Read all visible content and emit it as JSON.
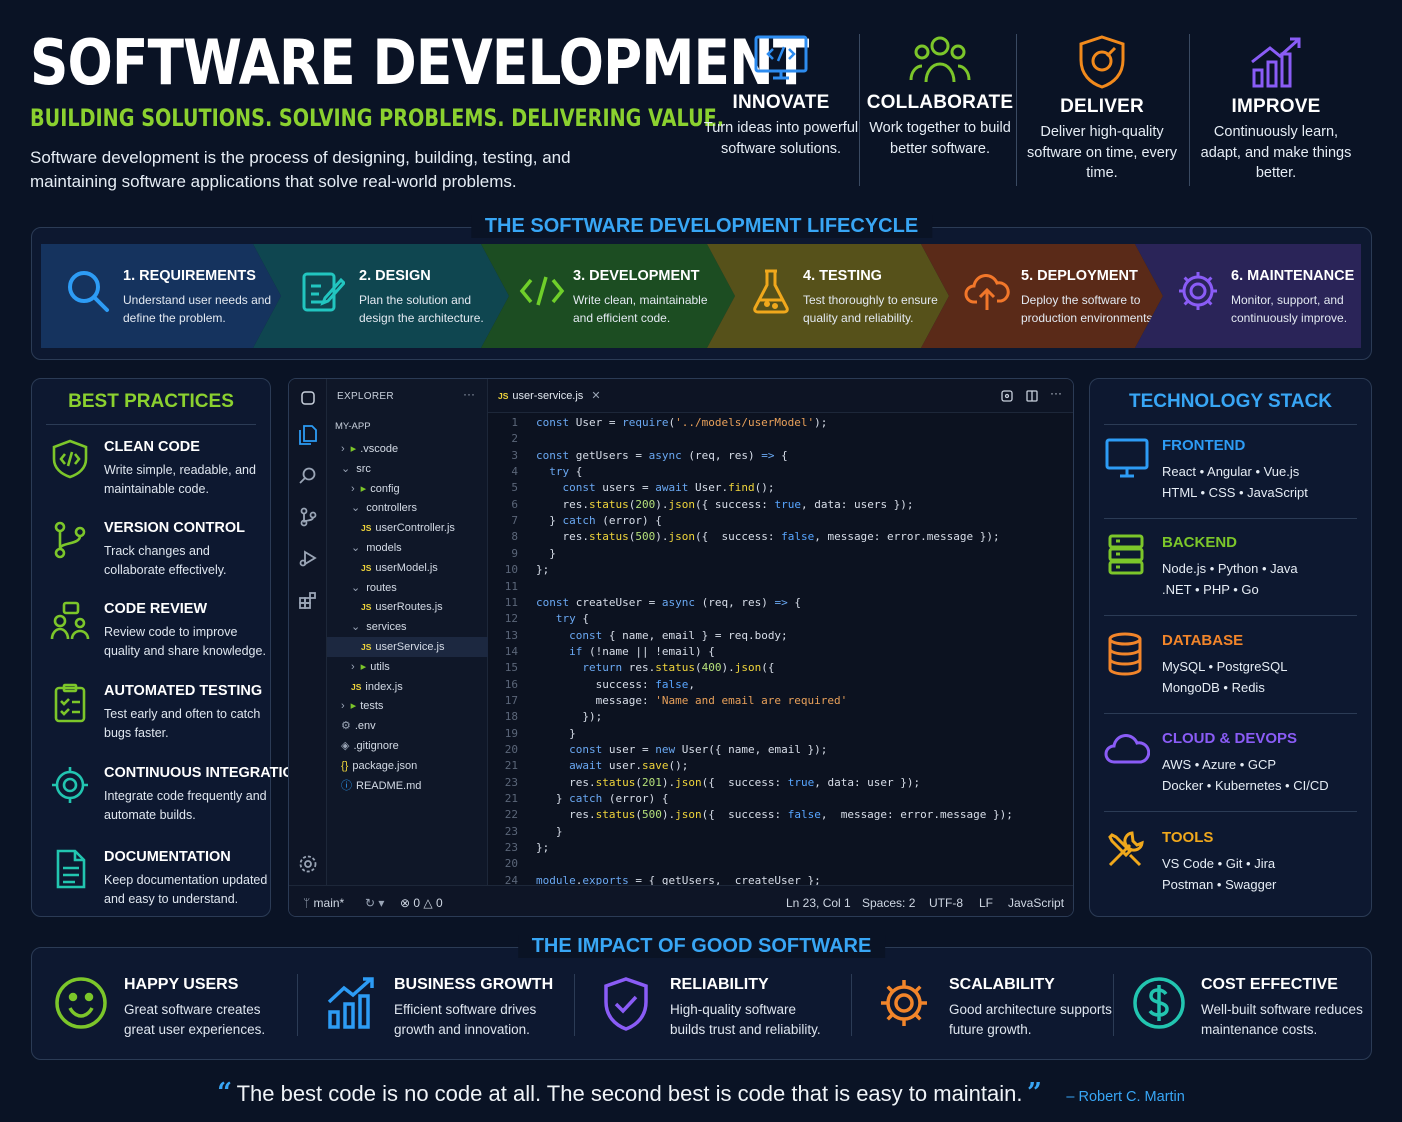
{
  "header": {
    "title": "SOFTWARE DEVELOPMENT",
    "tagline": "BUILDING SOLUTIONS. SOLVING PROBLEMS. DELIVERING VALUE.",
    "intro": "Software development is the process of designing, building, testing, and maintaining software applications that solve real-world problems."
  },
  "pillars": [
    {
      "title": "INNOVATE",
      "desc": "Turn ideas into powerful software solutions.",
      "icon": "monitor-code-icon",
      "color": "#2d8cf0"
    },
    {
      "title": "COLLABORATE",
      "desc": "Work together to build better software.",
      "icon": "team-icon",
      "color": "#7cc62a"
    },
    {
      "title": "DELIVER",
      "desc": "Deliver high-quality software on time, every time.",
      "icon": "shield-target-icon",
      "color": "#f28a1c"
    },
    {
      "title": "IMPROVE",
      "desc": "Continuously learn, adapt, and make things better.",
      "icon": "growth-chart-icon",
      "color": "#8a5cf6"
    }
  ],
  "lifecycle": {
    "heading": "THE SOFTWARE DEVELOPMENT LIFECYCLE",
    "stages": [
      {
        "title": "1. REQUIREMENTS",
        "desc": "Understand user needs and define the problem.",
        "icon": "search-icon",
        "color": "#15335e",
        "accent": "#2d9cf5"
      },
      {
        "title": "2. DESIGN",
        "desc": "Plan the solution and design the architecture.",
        "icon": "design-edit-icon",
        "color": "#0f4650",
        "accent": "#22c5c0"
      },
      {
        "title": "3. DEVELOPMENT",
        "desc": "Write clean, maintainable and efficient code.",
        "icon": "code-brackets-icon",
        "color": "#1c4d22",
        "accent": "#6fcf2a"
      },
      {
        "title": "4. TESTING",
        "desc": "Test thoroughly to ensure quality and reliability.",
        "icon": "flask-icon",
        "color": "#56511a",
        "accent": "#f0a81c"
      },
      {
        "title": "5. DEPLOYMENT",
        "desc": "Deploy the software to production environments.",
        "icon": "cloud-upload-icon",
        "color": "#5a2a18",
        "accent": "#f2772a"
      },
      {
        "title": "6. MAINTENANCE",
        "desc": "Monitor, support, and continuously improve.",
        "icon": "gear-cycle-icon",
        "color": "#2a2458",
        "accent": "#8a5cf6"
      }
    ]
  },
  "best_practices": {
    "heading": "BEST PRACTICES",
    "items": [
      {
        "title": "CLEAN CODE",
        "desc": "Write simple, readable, and maintainable code.",
        "icon": "clean-code-icon"
      },
      {
        "title": "VERSION CONTROL",
        "desc": "Track changes and collaborate effectively.",
        "icon": "branch-icon"
      },
      {
        "title": "CODE REVIEW",
        "desc": "Review code to improve quality and share knowledge.",
        "icon": "review-people-icon"
      },
      {
        "title": "AUTOMATED TESTING",
        "desc": "Test early and often to catch bugs faster.",
        "icon": "checklist-icon"
      },
      {
        "title": "CONTINUOUS INTEGRATION",
        "desc": "Integrate code frequently and automate builds.",
        "icon": "integration-target-icon"
      },
      {
        "title": "DOCUMENTATION",
        "desc": "Keep documentation updated and easy to understand.",
        "icon": "document-icon"
      }
    ]
  },
  "ide": {
    "explorer_label": "EXPLORER",
    "project": "MY-APP",
    "tree": [
      {
        "label": ".vscode",
        "type": "folder-closed",
        "indent": 0
      },
      {
        "label": "src",
        "type": "folder-open",
        "indent": 0
      },
      {
        "label": "config",
        "type": "folder-closed",
        "indent": 1
      },
      {
        "label": "controllers",
        "type": "folder-open",
        "indent": 1
      },
      {
        "label": "userController.js",
        "type": "js",
        "indent": 2
      },
      {
        "label": "models",
        "type": "folder-open",
        "indent": 1
      },
      {
        "label": "userModel.js",
        "type": "js",
        "indent": 2
      },
      {
        "label": "routes",
        "type": "folder-open",
        "indent": 1
      },
      {
        "label": "userRoutes.js",
        "type": "js",
        "indent": 2
      },
      {
        "label": "services",
        "type": "folder-open",
        "indent": 1
      },
      {
        "label": "userService.js",
        "type": "js",
        "indent": 2,
        "selected": true
      },
      {
        "label": "utils",
        "type": "folder-closed",
        "indent": 1
      },
      {
        "label": "index.js",
        "type": "js",
        "indent": 1
      },
      {
        "label": "tests",
        "type": "folder-closed",
        "indent": 0
      },
      {
        "label": ".env",
        "type": "gear",
        "indent": 0
      },
      {
        "label": ".gitignore",
        "type": "diamond",
        "indent": 0
      },
      {
        "label": "package.json",
        "type": "braces",
        "indent": 0
      },
      {
        "label": "README.md",
        "type": "info",
        "indent": 0
      }
    ],
    "tab": "user-service.js",
    "code_lines": [
      {
        "n": "1",
        "t": "const User = require('../models/userModel');"
      },
      {
        "n": "2",
        "t": ""
      },
      {
        "n": "3",
        "t": "const getUsers = async (req, res) => {"
      },
      {
        "n": "4",
        "t": "  try {"
      },
      {
        "n": "5",
        "t": "    const users = await User.find();"
      },
      {
        "n": "6",
        "t": "    res.status(200).json({ success: true, data: users });"
      },
      {
        "n": "7",
        "t": "  } catch (error) {"
      },
      {
        "n": "8",
        "t": "    res.status(500).json({  success: false, message: error.message });"
      },
      {
        "n": "9",
        "t": "  }"
      },
      {
        "n": "10",
        "t": "};"
      },
      {
        "n": "11",
        "t": ""
      },
      {
        "n": "11",
        "t": "const createUser = async (req, res) => {"
      },
      {
        "n": "12",
        "t": "   try {"
      },
      {
        "n": "13",
        "t": "     const { name, email } = req.body;"
      },
      {
        "n": "14",
        "t": "     if (!name || !email) {"
      },
      {
        "n": "15",
        "t": "       return res.status(400).json({"
      },
      {
        "n": "16",
        "t": "         success: false,"
      },
      {
        "n": "17",
        "t": "         message: 'Name and email are required'"
      },
      {
        "n": "18",
        "t": "       });"
      },
      {
        "n": "19",
        "t": "     }"
      },
      {
        "n": "20",
        "t": "     const user = new User({ name, email });"
      },
      {
        "n": "21",
        "t": "     await user.save();"
      },
      {
        "n": "23",
        "t": "     res.status(201).json({  success: true, data: user });"
      },
      {
        "n": "21",
        "t": "   } catch (error) {"
      },
      {
        "n": "22",
        "t": "     res.status(500).json({  success: false,  message: error.message });"
      },
      {
        "n": "23",
        "t": "   }"
      },
      {
        "n": "23",
        "t": "};"
      },
      {
        "n": "20",
        "t": ""
      },
      {
        "n": "24",
        "t": "module.exports = { getUsers,  createUser };"
      }
    ],
    "status": {
      "branch": "main*",
      "errors": "0",
      "warnings": "0",
      "position": "Ln 23, Col 1",
      "spaces": "Spaces: 2",
      "encoding": "UTF-8",
      "eol": "LF",
      "language": "JavaScript"
    }
  },
  "tech_stack": {
    "heading": "TECHNOLOGY STACK",
    "items": [
      {
        "title": "FRONTEND",
        "line1": "React  •  Angular  •  Vue.js",
        "line2": "HTML  •  CSS  •  JavaScript",
        "icon": "monitor-icon",
        "color": "#2d9cf5"
      },
      {
        "title": "BACKEND",
        "line1": "Node.js  •  Python  •  Java",
        "line2": ".NET  •  PHP  •  Go",
        "icon": "server-icon",
        "color": "#7cc62a"
      },
      {
        "title": "DATABASE",
        "line1": "MySQL  •  PostgreSQL",
        "line2": "MongoDB  •  Redis",
        "icon": "database-icon",
        "color": "#f2852a"
      },
      {
        "title": "CLOUD & DEVOPS",
        "line1": "AWS  •  Azure  •  GCP",
        "line2": "Docker  •  Kubernetes  •  CI/CD",
        "icon": "cloud-icon",
        "color": "#8a5cf6"
      },
      {
        "title": "TOOLS",
        "line1": "VS Code  •  Git  •  Jira",
        "line2": "Postman  •  Swagger",
        "icon": "tools-icon",
        "color": "#f0a81c"
      }
    ]
  },
  "impact": {
    "heading": "THE IMPACT OF GOOD SOFTWARE",
    "items": [
      {
        "title": "HAPPY USERS",
        "desc1": "Great software creates",
        "desc2": "great user experiences.",
        "icon": "smiley-icon",
        "color": "#7cc62a"
      },
      {
        "title": "BUSINESS GROWTH",
        "desc1": "Efficient software drives",
        "desc2": "growth and innovation.",
        "icon": "bar-growth-icon",
        "color": "#2d9cf5"
      },
      {
        "title": "RELIABILITY",
        "desc1": "High-quality software",
        "desc2": "builds trust and reliability.",
        "icon": "shield-check-icon",
        "color": "#8a5cf6"
      },
      {
        "title": "SCALABILITY",
        "desc1": "Good architecture supports",
        "desc2": "future growth.",
        "icon": "gear-icon",
        "color": "#f2852a"
      },
      {
        "title": "COST EFFECTIVE",
        "desc1": "Well-built software reduces",
        "desc2": "maintenance costs.",
        "icon": "dollar-icon",
        "color": "#22c5b0"
      }
    ]
  },
  "quote": {
    "open": "“",
    "text": "The best code is no code at all. The second best is code that is easy to maintain.",
    "close": "”",
    "author": "– Robert C. Martin"
  }
}
